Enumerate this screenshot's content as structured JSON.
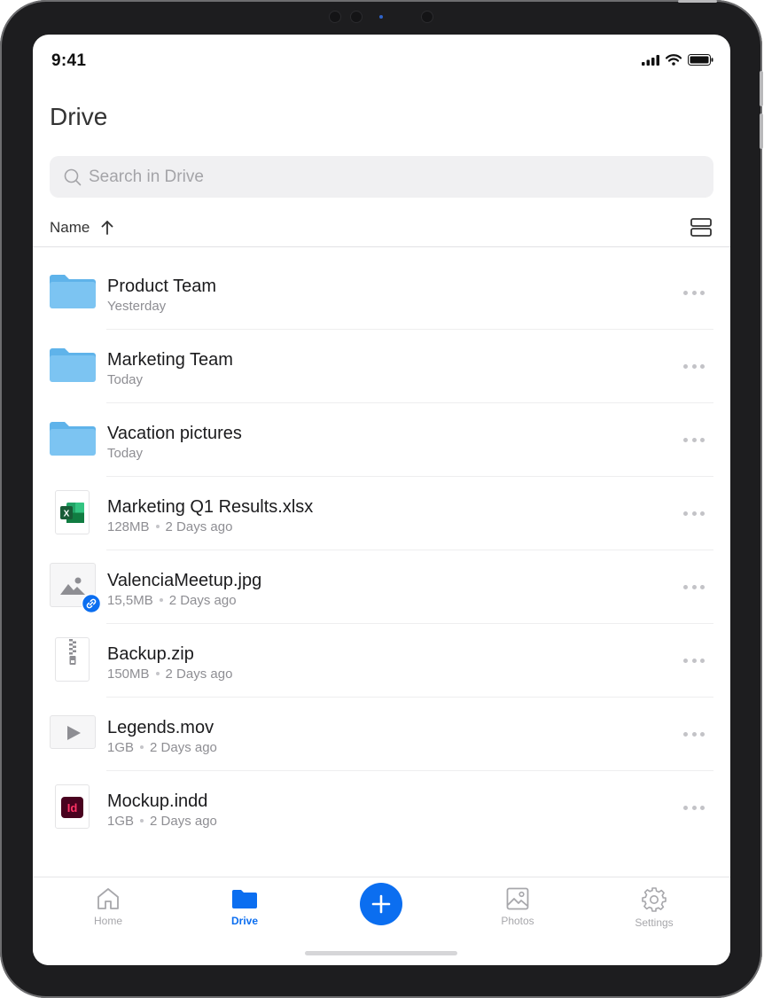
{
  "status_bar": {
    "time": "9:41"
  },
  "page": {
    "title": "Drive"
  },
  "search": {
    "placeholder": "Search in Drive"
  },
  "sort": {
    "label": "Name"
  },
  "files": [
    {
      "name": "Product Team",
      "meta": "Yesterday",
      "type": "folder"
    },
    {
      "name": "Marketing Team",
      "meta": "Today",
      "type": "folder"
    },
    {
      "name": "Vacation pictures",
      "meta": "Today",
      "type": "folder"
    },
    {
      "name": "Marketing Q1 Results.xlsx",
      "size": "128MB",
      "date": "2 Days ago",
      "type": "excel-file"
    },
    {
      "name": "ValenciaMeetup.jpg",
      "size": "15,5MB",
      "date": "2 Days ago",
      "type": "image-file",
      "shared_link": true
    },
    {
      "name": "Backup.zip",
      "size": "150MB",
      "date": "2 Days ago",
      "type": "zip-file"
    },
    {
      "name": "Legends.mov",
      "size": "1GB",
      "date": "2 Days ago",
      "type": "video-file"
    },
    {
      "name": "Mockup.indd",
      "size": "1GB",
      "date": "2 Days ago",
      "type": "indesign-file"
    }
  ],
  "tab_bar": {
    "home": "Home",
    "drive": "Drive",
    "photos": "Photos",
    "settings": "Settings",
    "active": "Drive"
  },
  "colors": {
    "accent": "#0b6ef0",
    "folder": "#7cc4f2",
    "excel": "#1f7a45",
    "indesign": "#ff3366"
  },
  "icons": [
    "search-icon",
    "sort-arrow-up-icon",
    "view-toggle-icon",
    "folder-icon",
    "excel-icon",
    "image-icon",
    "link-icon",
    "zip-icon",
    "play-icon",
    "indesign-icon",
    "more-icon",
    "home-icon",
    "plus-icon",
    "photos-icon",
    "gear-icon"
  ]
}
